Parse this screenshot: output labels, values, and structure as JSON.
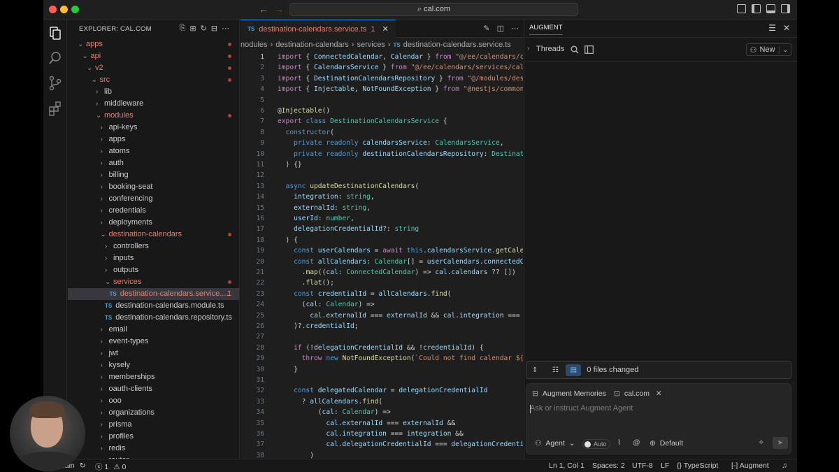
{
  "window": {
    "command_center": "cal.com",
    "search_glyph": "⌕",
    "nav_back": "←",
    "nav_fwd": "→"
  },
  "explorer": {
    "title": "EXPLORER: CAL.COM",
    "tree": [
      {
        "label": "apps",
        "depth": 0,
        "kind": "folder",
        "open": true,
        "modified": true,
        "dot": true
      },
      {
        "label": "api",
        "depth": 1,
        "kind": "folder",
        "open": true,
        "modified": true,
        "dot": true
      },
      {
        "label": "v2",
        "depth": 2,
        "kind": "folder",
        "open": true,
        "modified": true,
        "dot": true
      },
      {
        "label": "src",
        "depth": 3,
        "kind": "folder",
        "open": true,
        "modified": true,
        "dot": true
      },
      {
        "label": "lib",
        "depth": 4,
        "kind": "folder",
        "open": false,
        "modified": false,
        "dot": false
      },
      {
        "label": "middleware",
        "depth": 4,
        "kind": "folder",
        "open": false,
        "modified": false,
        "dot": false
      },
      {
        "label": "modules",
        "depth": 4,
        "kind": "folder",
        "open": true,
        "modified": true,
        "dot": true
      },
      {
        "label": "api-keys",
        "depth": 5,
        "kind": "folder",
        "open": false,
        "modified": false,
        "dot": false
      },
      {
        "label": "apps",
        "depth": 5,
        "kind": "folder",
        "open": false,
        "modified": false,
        "dot": false
      },
      {
        "label": "atoms",
        "depth": 5,
        "kind": "folder",
        "open": false,
        "modified": false,
        "dot": false
      },
      {
        "label": "auth",
        "depth": 5,
        "kind": "folder",
        "open": false,
        "modified": false,
        "dot": false
      },
      {
        "label": "billing",
        "depth": 5,
        "kind": "folder",
        "open": false,
        "modified": false,
        "dot": false
      },
      {
        "label": "booking-seat",
        "depth": 5,
        "kind": "folder",
        "open": false,
        "modified": false,
        "dot": false
      },
      {
        "label": "conferencing",
        "depth": 5,
        "kind": "folder",
        "open": false,
        "modified": false,
        "dot": false
      },
      {
        "label": "credentials",
        "depth": 5,
        "kind": "folder",
        "open": false,
        "modified": false,
        "dot": false
      },
      {
        "label": "deployments",
        "depth": 5,
        "kind": "folder",
        "open": false,
        "modified": false,
        "dot": false
      },
      {
        "label": "destination-calendars",
        "depth": 5,
        "kind": "folder",
        "open": true,
        "modified": true,
        "dot": true
      },
      {
        "label": "controllers",
        "depth": 6,
        "kind": "folder",
        "open": false,
        "modified": false,
        "dot": false
      },
      {
        "label": "inputs",
        "depth": 6,
        "kind": "folder",
        "open": false,
        "modified": false,
        "dot": false
      },
      {
        "label": "outputs",
        "depth": 6,
        "kind": "folder",
        "open": false,
        "modified": false,
        "dot": false
      },
      {
        "label": "services",
        "depth": 6,
        "kind": "folder",
        "open": true,
        "modified": true,
        "dot": true
      },
      {
        "label": "destination-calendars.service....",
        "depth": 7,
        "kind": "ts",
        "modified": true,
        "selected": true,
        "badge": "1"
      },
      {
        "label": "destination-calendars.module.ts",
        "depth": 6,
        "kind": "ts",
        "modified": false
      },
      {
        "label": "destination-calendars.repository.ts",
        "depth": 6,
        "kind": "ts",
        "modified": false
      },
      {
        "label": "email",
        "depth": 5,
        "kind": "folder",
        "open": false,
        "modified": false,
        "dot": false
      },
      {
        "label": "event-types",
        "depth": 5,
        "kind": "folder",
        "open": false,
        "modified": false,
        "dot": false
      },
      {
        "label": "jwt",
        "depth": 5,
        "kind": "folder",
        "open": false,
        "modified": false,
        "dot": false
      },
      {
        "label": "kysely",
        "depth": 5,
        "kind": "folder",
        "open": false,
        "modified": false,
        "dot": false
      },
      {
        "label": "memberships",
        "depth": 5,
        "kind": "folder",
        "open": false,
        "modified": false,
        "dot": false
      },
      {
        "label": "oauth-clients",
        "depth": 5,
        "kind": "folder",
        "open": false,
        "modified": false,
        "dot": false
      },
      {
        "label": "ooo",
        "depth": 5,
        "kind": "folder",
        "open": false,
        "modified": false,
        "dot": false
      },
      {
        "label": "organizations",
        "depth": 5,
        "kind": "folder",
        "open": false,
        "modified": false,
        "dot": false
      },
      {
        "label": "prisma",
        "depth": 5,
        "kind": "folder",
        "open": false,
        "modified": false,
        "dot": false
      },
      {
        "label": "profiles",
        "depth": 5,
        "kind": "folder",
        "open": false,
        "modified": false,
        "dot": false
      },
      {
        "label": "redis",
        "depth": 5,
        "kind": "folder",
        "open": false,
        "modified": false,
        "dot": false
      },
      {
        "label": "router",
        "depth": 5,
        "kind": "folder",
        "open": false,
        "modified": false,
        "dot": false
      }
    ]
  },
  "editor": {
    "tab": {
      "label": "destination-calendars.service.ts",
      "badge": "1",
      "lang": "TS"
    },
    "breadcrumb": [
      "nodules",
      "destination-calendars",
      "services",
      "destination-calendars.service.ts"
    ],
    "lines": [
      [
        [
          "kw",
          "import"
        ],
        [
          "p",
          " { "
        ],
        [
          "id",
          "ConnectedCalendar"
        ],
        [
          "p",
          ", "
        ],
        [
          "id",
          "Calendar"
        ],
        [
          "p",
          " } "
        ],
        [
          "kw",
          "from"
        ],
        [
          "p",
          " "
        ],
        [
          "str",
          "\"@/ee/calendars/c"
        ]
      ],
      [
        [
          "kw",
          "import"
        ],
        [
          "p",
          " { "
        ],
        [
          "id",
          "CalendarsService"
        ],
        [
          "p",
          " } "
        ],
        [
          "kw",
          "from"
        ],
        [
          "p",
          " "
        ],
        [
          "str",
          "\"@/ee/calendars/services/cal"
        ]
      ],
      [
        [
          "kw",
          "import"
        ],
        [
          "p",
          " { "
        ],
        [
          "id",
          "DestinationCalendarsRepository"
        ],
        [
          "p",
          " } "
        ],
        [
          "kw",
          "from"
        ],
        [
          "p",
          " "
        ],
        [
          "str",
          "\"@/modules/des"
        ]
      ],
      [
        [
          "kw",
          "import"
        ],
        [
          "p",
          " { "
        ],
        [
          "id",
          "Injectable"
        ],
        [
          "p",
          ", "
        ],
        [
          "id",
          "NotFoundException"
        ],
        [
          "p",
          " } "
        ],
        [
          "kw",
          "from"
        ],
        [
          "p",
          " "
        ],
        [
          "str",
          "\"@nestjs/common"
        ]
      ],
      [],
      [
        [
          "p",
          "@"
        ],
        [
          "fn",
          "Injectable"
        ],
        [
          "p",
          "()"
        ]
      ],
      [
        [
          "kw",
          "export"
        ],
        [
          "p",
          " "
        ],
        [
          "kw2",
          "class"
        ],
        [
          "p",
          " "
        ],
        [
          "ty",
          "DestinationCalendarsService"
        ],
        [
          "p",
          " {"
        ]
      ],
      [
        [
          "p",
          "  "
        ],
        [
          "kw2",
          "constructor"
        ],
        [
          "p",
          "("
        ]
      ],
      [
        [
          "p",
          "    "
        ],
        [
          "kw2",
          "private"
        ],
        [
          "p",
          " "
        ],
        [
          "kw2",
          "readonly"
        ],
        [
          "p",
          " "
        ],
        [
          "id",
          "calendarsService"
        ],
        [
          "p",
          ": "
        ],
        [
          "ty",
          "CalendarsService"
        ],
        [
          "p",
          ","
        ]
      ],
      [
        [
          "p",
          "    "
        ],
        [
          "kw2",
          "private"
        ],
        [
          "p",
          " "
        ],
        [
          "kw2",
          "readonly"
        ],
        [
          "p",
          " "
        ],
        [
          "id",
          "destinationCalendarsRepository"
        ],
        [
          "p",
          ": "
        ],
        [
          "ty",
          "Destinat"
        ]
      ],
      [
        [
          "p",
          "  ) {}"
        ]
      ],
      [],
      [
        [
          "p",
          "  "
        ],
        [
          "kw2",
          "async"
        ],
        [
          "p",
          " "
        ],
        [
          "fn",
          "updateDestinationCalendars"
        ],
        [
          "p",
          "("
        ]
      ],
      [
        [
          "p",
          "    "
        ],
        [
          "id",
          "integration"
        ],
        [
          "p",
          ": "
        ],
        [
          "ty",
          "string"
        ],
        [
          "p",
          ","
        ]
      ],
      [
        [
          "p",
          "    "
        ],
        [
          "id",
          "externalId"
        ],
        [
          "p",
          ": "
        ],
        [
          "ty",
          "string"
        ],
        [
          "p",
          ","
        ]
      ],
      [
        [
          "p",
          "    "
        ],
        [
          "id",
          "userId"
        ],
        [
          "p",
          ": "
        ],
        [
          "ty",
          "number"
        ],
        [
          "p",
          ","
        ]
      ],
      [
        [
          "p",
          "    "
        ],
        [
          "id",
          "delegationCredentialId"
        ],
        [
          "p",
          "?: "
        ],
        [
          "ty",
          "string"
        ]
      ],
      [
        [
          "p",
          "  ) {"
        ]
      ],
      [
        [
          "p",
          "    "
        ],
        [
          "kw2",
          "const"
        ],
        [
          "p",
          " "
        ],
        [
          "id",
          "userCalendars"
        ],
        [
          "p",
          " = "
        ],
        [
          "kw",
          "await"
        ],
        [
          "p",
          " "
        ],
        [
          "kw2",
          "this"
        ],
        [
          "p",
          "."
        ],
        [
          "id",
          "calendarsService"
        ],
        [
          "p",
          "."
        ],
        [
          "fn",
          "getCale"
        ]
      ],
      [
        [
          "p",
          "    "
        ],
        [
          "kw2",
          "const"
        ],
        [
          "p",
          " "
        ],
        [
          "id",
          "allCalendars"
        ],
        [
          "p",
          ": "
        ],
        [
          "ty",
          "Calendar"
        ],
        [
          "p",
          "[] = "
        ],
        [
          "id",
          "userCalendars"
        ],
        [
          "p",
          "."
        ],
        [
          "id",
          "connectedC"
        ]
      ],
      [
        [
          "p",
          "      ."
        ],
        [
          "fn",
          "map"
        ],
        [
          "p",
          "(("
        ],
        [
          "id",
          "cal"
        ],
        [
          "p",
          ": "
        ],
        [
          "ty",
          "ConnectedCalendar"
        ],
        [
          "p",
          ") => "
        ],
        [
          "id",
          "cal"
        ],
        [
          "p",
          "."
        ],
        [
          "id",
          "calendars"
        ],
        [
          "p",
          " ?? [])"
        ]
      ],
      [
        [
          "p",
          "      ."
        ],
        [
          "fn",
          "flat"
        ],
        [
          "p",
          "();"
        ]
      ],
      [
        [
          "p",
          "    "
        ],
        [
          "kw2",
          "const"
        ],
        [
          "p",
          " "
        ],
        [
          "id",
          "credentialId"
        ],
        [
          "p",
          " = "
        ],
        [
          "id",
          "allCalendars"
        ],
        [
          "p",
          "."
        ],
        [
          "fn",
          "find"
        ],
        [
          "p",
          "("
        ]
      ],
      [
        [
          "p",
          "      ("
        ],
        [
          "id",
          "cal"
        ],
        [
          "p",
          ": "
        ],
        [
          "ty",
          "Calendar"
        ],
        [
          "p",
          ") =>"
        ]
      ],
      [
        [
          "p",
          "        "
        ],
        [
          "id",
          "cal"
        ],
        [
          "p",
          "."
        ],
        [
          "id",
          "externalId"
        ],
        [
          "p",
          " === "
        ],
        [
          "id",
          "externalId"
        ],
        [
          "p",
          " && "
        ],
        [
          "id",
          "cal"
        ],
        [
          "p",
          "."
        ],
        [
          "id",
          "integration"
        ],
        [
          "p",
          " ==="
        ]
      ],
      [
        [
          "p",
          "    )?."
        ],
        [
          "id",
          "credentialId"
        ],
        [
          "p",
          ";"
        ]
      ],
      [],
      [
        [
          "p",
          "    "
        ],
        [
          "kw",
          "if"
        ],
        [
          "p",
          " (!"
        ],
        [
          "id",
          "delegationCredentialId"
        ],
        [
          "p",
          " && !"
        ],
        [
          "id",
          "credentialId"
        ],
        [
          "p",
          ") {"
        ]
      ],
      [
        [
          "p",
          "      "
        ],
        [
          "kw",
          "throw"
        ],
        [
          "p",
          " "
        ],
        [
          "kw2",
          "new"
        ],
        [
          "p",
          " "
        ],
        [
          "fn",
          "NotFoundException"
        ],
        [
          "p",
          "("
        ],
        [
          "str",
          "`Could not find calendar ${"
        ]
      ],
      [
        [
          "p",
          "    }"
        ]
      ],
      [],
      [
        [
          "p",
          "    "
        ],
        [
          "kw2",
          "const"
        ],
        [
          "p",
          " "
        ],
        [
          "id",
          "delegatedCalendar"
        ],
        [
          "p",
          " = "
        ],
        [
          "id",
          "delegationCredentialId"
        ]
      ],
      [
        [
          "p",
          "      ? "
        ],
        [
          "id",
          "allCalendars"
        ],
        [
          "p",
          "."
        ],
        [
          "fn",
          "find"
        ],
        [
          "p",
          "("
        ]
      ],
      [
        [
          "p",
          "          ("
        ],
        [
          "id",
          "cal"
        ],
        [
          "p",
          ": "
        ],
        [
          "ty",
          "Calendar"
        ],
        [
          "p",
          ") =>"
        ]
      ],
      [
        [
          "p",
          "            "
        ],
        [
          "id",
          "cal"
        ],
        [
          "p",
          "."
        ],
        [
          "id",
          "externalId"
        ],
        [
          "p",
          " === "
        ],
        [
          "id",
          "externalId"
        ],
        [
          "p",
          " &&"
        ]
      ],
      [
        [
          "p",
          "            "
        ],
        [
          "id",
          "cal"
        ],
        [
          "p",
          "."
        ],
        [
          "id",
          "integration"
        ],
        [
          "p",
          " === "
        ],
        [
          "id",
          "integration"
        ],
        [
          "p",
          " &&"
        ]
      ],
      [
        [
          "p",
          "            "
        ],
        [
          "id",
          "cal"
        ],
        [
          "p",
          "."
        ],
        [
          "id",
          "delegationCredentialId"
        ],
        [
          "p",
          " === "
        ],
        [
          "id",
          "delegationCredenti"
        ]
      ],
      [
        [
          "p",
          "        )"
        ]
      ]
    ]
  },
  "augment": {
    "title": "AUGMENT",
    "threads_label": "Threads",
    "new_label": "New",
    "files_changed": "0 files changed",
    "chips": [
      {
        "label": "Augment Memories"
      },
      {
        "label": "cal.com"
      }
    ],
    "placeholder": "Ask or instruct Augment Agent",
    "mode_label": "Agent",
    "auto_label": "Auto",
    "model_label": "Default"
  },
  "status": {
    "branch": "main",
    "errors": "1",
    "warnings": "0",
    "cursor": "Ln 1, Col 1",
    "spaces": "Spaces: 2",
    "encoding": "UTF-8",
    "eol": "LF",
    "language": "TypeScript",
    "augment": "Augment"
  }
}
